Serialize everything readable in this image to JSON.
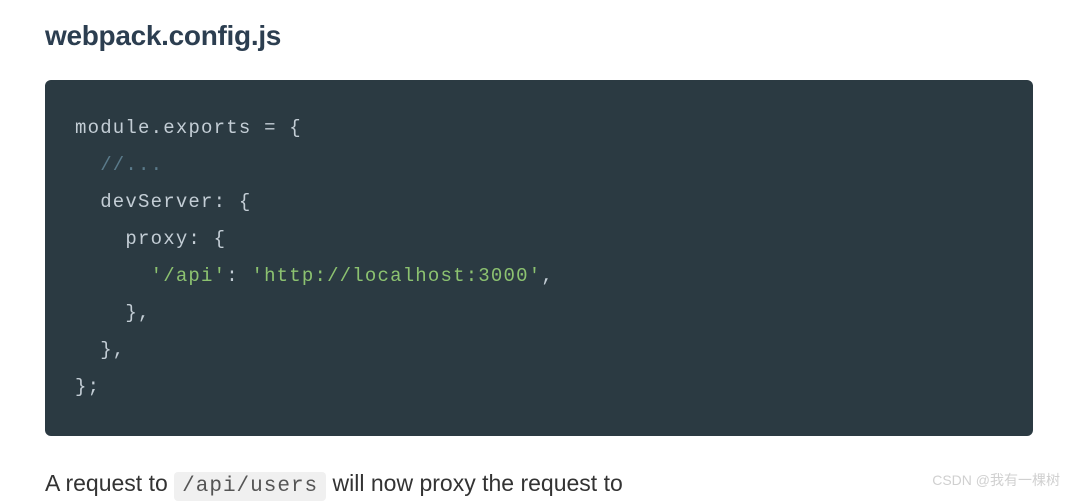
{
  "heading": "webpack.config.js",
  "code": {
    "l1_a": "module",
    "l1_b": ".",
    "l1_c": "exports ",
    "l1_d": "=",
    "l1_e": " {",
    "l2": "  //...",
    "l3_a": "  devServer",
    "l3_b": ":",
    "l3_c": " {",
    "l4_a": "    proxy",
    "l4_b": ":",
    "l4_c": " {",
    "l5_a": "      ",
    "l5_b": "'/api'",
    "l5_c": ":",
    "l5_d": " ",
    "l5_e": "'http://localhost:3000'",
    "l5_f": ",",
    "l6": "    },",
    "l7": "  },",
    "l8": "};"
  },
  "body": {
    "before": "A request to ",
    "inline": "/api/users",
    "after": " will now proxy the request to"
  },
  "watermark": "CSDN @我有一棵树"
}
